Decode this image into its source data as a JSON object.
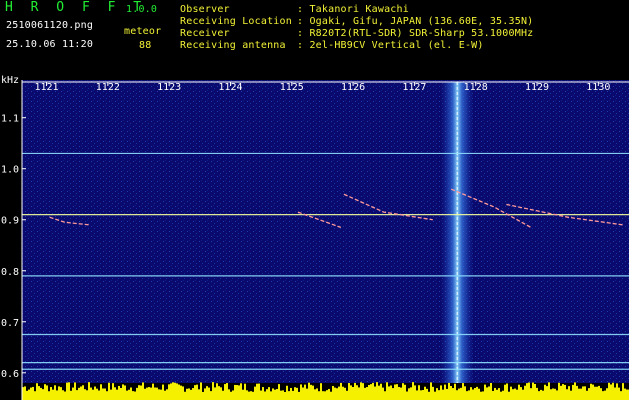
{
  "header": {
    "app_title": "H R O F F T",
    "version": "1.0.0",
    "filename": "2510061120.png",
    "datetime": "25.10.06 11:20",
    "meteor_label": "meteor",
    "meteor_count": "88",
    "fields": [
      {
        "label": "Observer",
        "value": ": Takanori Kawachi"
      },
      {
        "label": "Receiving Location",
        "value": ": Ogaki, Gifu, JAPAN (136.60E, 35.35N)"
      },
      {
        "label": "Receiver",
        "value": ": R820T2(RTL-SDR) SDR-Sharp 53.1000MHz"
      },
      {
        "label": "Receiving antenna",
        "value": ": 2el-HB9CV Vertical (el. E-W)"
      }
    ]
  },
  "colors": {
    "header_green": "#22ee33",
    "header_yellow": "#f2f236",
    "background_blue": "#0a0a6e",
    "carrier_line": "#8fe0ff"
  },
  "chart_data": {
    "type": "heatmap",
    "title": "",
    "xlabel": "",
    "ylabel": "kHz",
    "x_ticks": [
      "1121",
      "1122",
      "1123",
      "1124",
      "1125",
      "1126",
      "1127",
      "1128",
      "1129",
      "1130"
    ],
    "y_ticks": [
      "1.1",
      "1.0",
      "0.9",
      "0.8",
      "0.7",
      "0.6"
    ],
    "xlim": [
      1120.6,
      1130.5
    ],
    "ylim": [
      0.58,
      1.17
    ],
    "horizontal_lines_khz": [
      1.03,
      0.91,
      0.79,
      0.675,
      0.62,
      0.607
    ],
    "vertical_interference_x": 1127.7,
    "meteor_traces": [
      {
        "x": [
          1121.05,
          1121.3,
          1121.7
        ],
        "y": [
          0.905,
          0.895,
          0.89
        ]
      },
      {
        "x": [
          1125.1,
          1125.8
        ],
        "y": [
          0.915,
          0.885
        ]
      },
      {
        "x": [
          1125.85,
          1126.5,
          1127.3
        ],
        "y": [
          0.95,
          0.915,
          0.9
        ]
      },
      {
        "x": [
          1127.6,
          1128.3,
          1128.9
        ],
        "y": [
          0.96,
          0.925,
          0.885
        ]
      },
      {
        "x": [
          1128.5,
          1129.5,
          1130.4
        ],
        "y": [
          0.93,
          0.905,
          0.89
        ]
      }
    ]
  }
}
